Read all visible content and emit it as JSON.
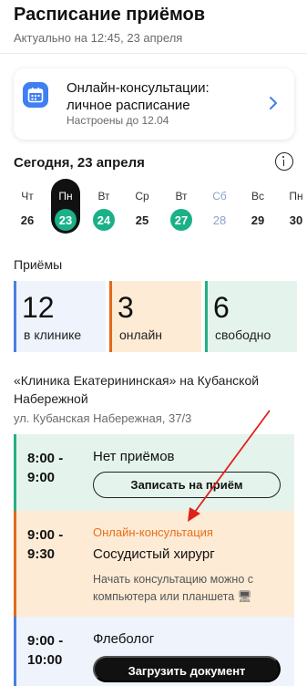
{
  "header": {
    "title": "Расписание приёмов",
    "updated": "Актуально на 12:45, 23 апреля"
  },
  "online_card": {
    "title": "Онлайн-консультации: личное расписание",
    "subtitle": "Настроены до 12.04",
    "icon": "calendar-icon",
    "accent": "#3f7ff2"
  },
  "today": {
    "label": "Сегодня, 23 апреля",
    "info_icon": "info-icon"
  },
  "days": [
    {
      "dow": "Чт",
      "num": "26",
      "state": "normal"
    },
    {
      "dow": "Пн",
      "num": "23",
      "state": "active"
    },
    {
      "dow": "Вт",
      "num": "24",
      "state": "green"
    },
    {
      "dow": "Ср",
      "num": "25",
      "state": "normal"
    },
    {
      "dow": "Вт",
      "num": "27",
      "state": "green"
    },
    {
      "dow": "Сб",
      "num": "28",
      "state": "muted"
    },
    {
      "dow": "Вс",
      "num": "29",
      "state": "normal"
    },
    {
      "dow": "Пн",
      "num": "30",
      "state": "normal"
    }
  ],
  "appointments": {
    "label": "Приёмы",
    "stats": [
      {
        "value": "12",
        "label": "в клинике",
        "bg": "#eef3fc",
        "bar": "#4a7fe0"
      },
      {
        "value": "3",
        "label": "онлайн",
        "bg": "#fdebd5",
        "bar": "#e06a1c"
      },
      {
        "value": "6",
        "label": "свободно",
        "bg": "#e4f4ec",
        "bar": "#24b083"
      }
    ]
  },
  "clinic": {
    "name": "«Клиника Екатерининская» на Кубанской Набережной",
    "address": "ул. Кубанская Набережная, 37/3"
  },
  "slots": [
    {
      "time": "8:00 -\n9:00",
      "title": "Нет приёмов",
      "button": "Записать на приём",
      "bg": "#e4f4ec",
      "bar": "#24b083"
    },
    {
      "time": "9:00 -\n9:30",
      "tag": "Онлайн-консультация",
      "title": "Сосудистый хирург",
      "note": "Начать консультацию можно с компьютера или планшета 🖥",
      "bg": "#fdebd5",
      "bar": "#e06a1c"
    },
    {
      "time": "9:00 -\n10:00",
      "title": "Флеболог",
      "button": "Загрузить документ",
      "bg": "#eef3fc",
      "bar": "#4a7fe0"
    }
  ],
  "annotation_color": "#e0201c"
}
